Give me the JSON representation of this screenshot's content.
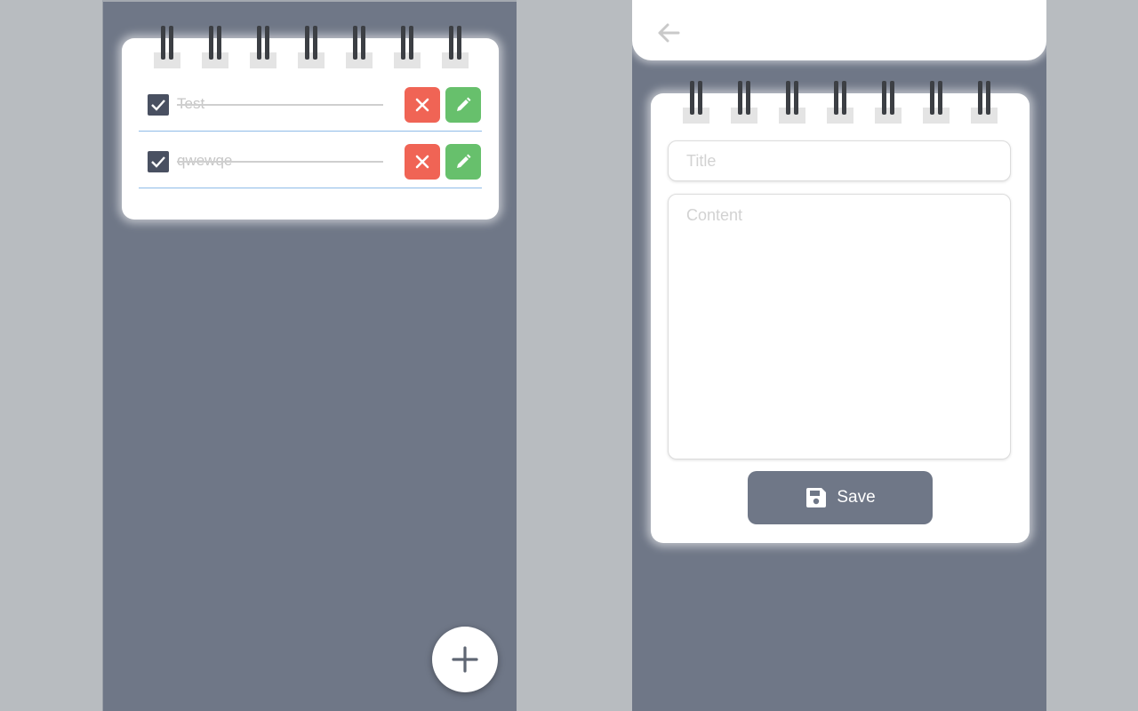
{
  "list_screen": {
    "todos": [
      {
        "text": "Test",
        "checked": true,
        "completed": true
      },
      {
        "text": "qwewqe",
        "checked": true,
        "completed": true
      }
    ],
    "ring_count": 7,
    "add_icon": "plus-icon"
  },
  "edit_screen": {
    "back_icon": "arrow-left-icon",
    "title_placeholder": "Title",
    "content_placeholder": "Content",
    "save_label": "Save",
    "save_icon": "floppy-disk-icon",
    "ring_count": 7
  },
  "colors": {
    "screen_bg": "#6f7787",
    "page_bg": "#b8bcc0",
    "delete": "#f06455",
    "edit": "#67c06c",
    "checkbox": "#495061",
    "divider": "#8fbbe8"
  }
}
